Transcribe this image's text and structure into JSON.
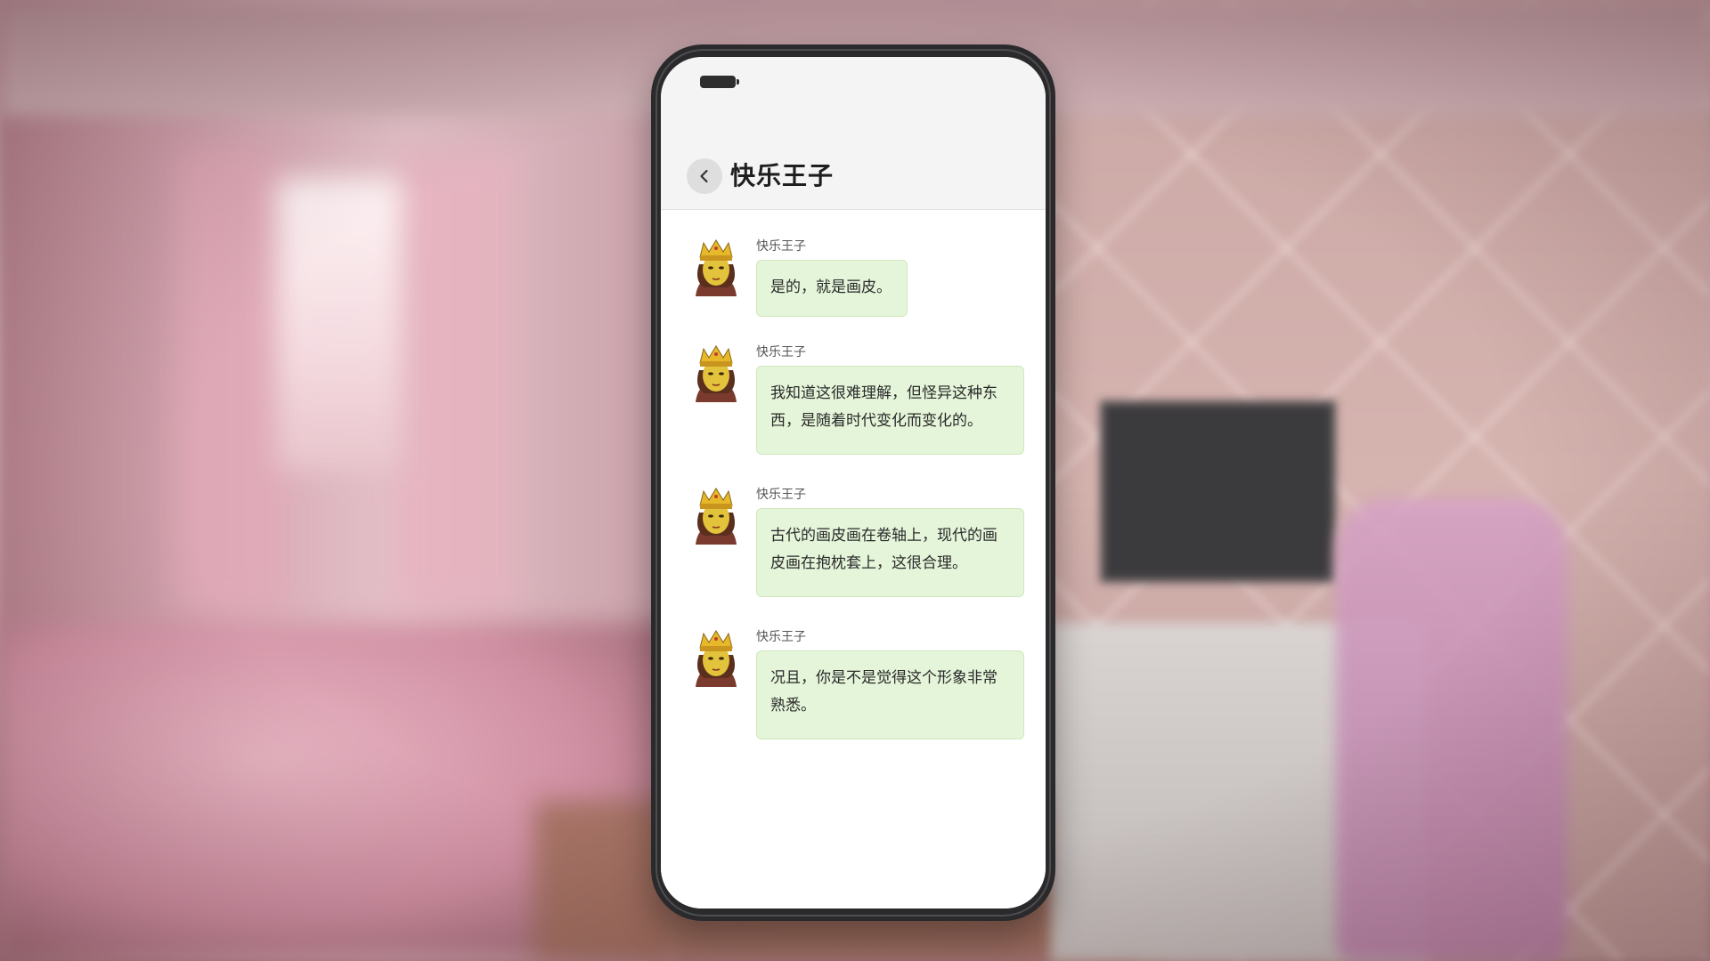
{
  "chat": {
    "title": "快乐王子",
    "back_icon": "chevron-left-icon",
    "messages": [
      {
        "sender": "快乐王子",
        "text": "是的，就是画皮。",
        "avatar": "crowned-prince-avatar"
      },
      {
        "sender": "快乐王子",
        "text": "我知道这很难理解，但怪异这种东西，是随着时代变化而变化的。",
        "avatar": "crowned-prince-avatar"
      },
      {
        "sender": "快乐王子",
        "text": "古代的画皮画在卷轴上，现代的画皮画在抱枕套上，这很合理。",
        "avatar": "crowned-prince-avatar"
      },
      {
        "sender": "快乐王子",
        "text": "况且，你是不是觉得这个形象非常熟悉。",
        "avatar": "crowned-prince-avatar"
      }
    ]
  },
  "colors": {
    "bubble": "#e4f5d9",
    "header": "#f4f4f4",
    "phone_frame": "#2a2a2c"
  }
}
